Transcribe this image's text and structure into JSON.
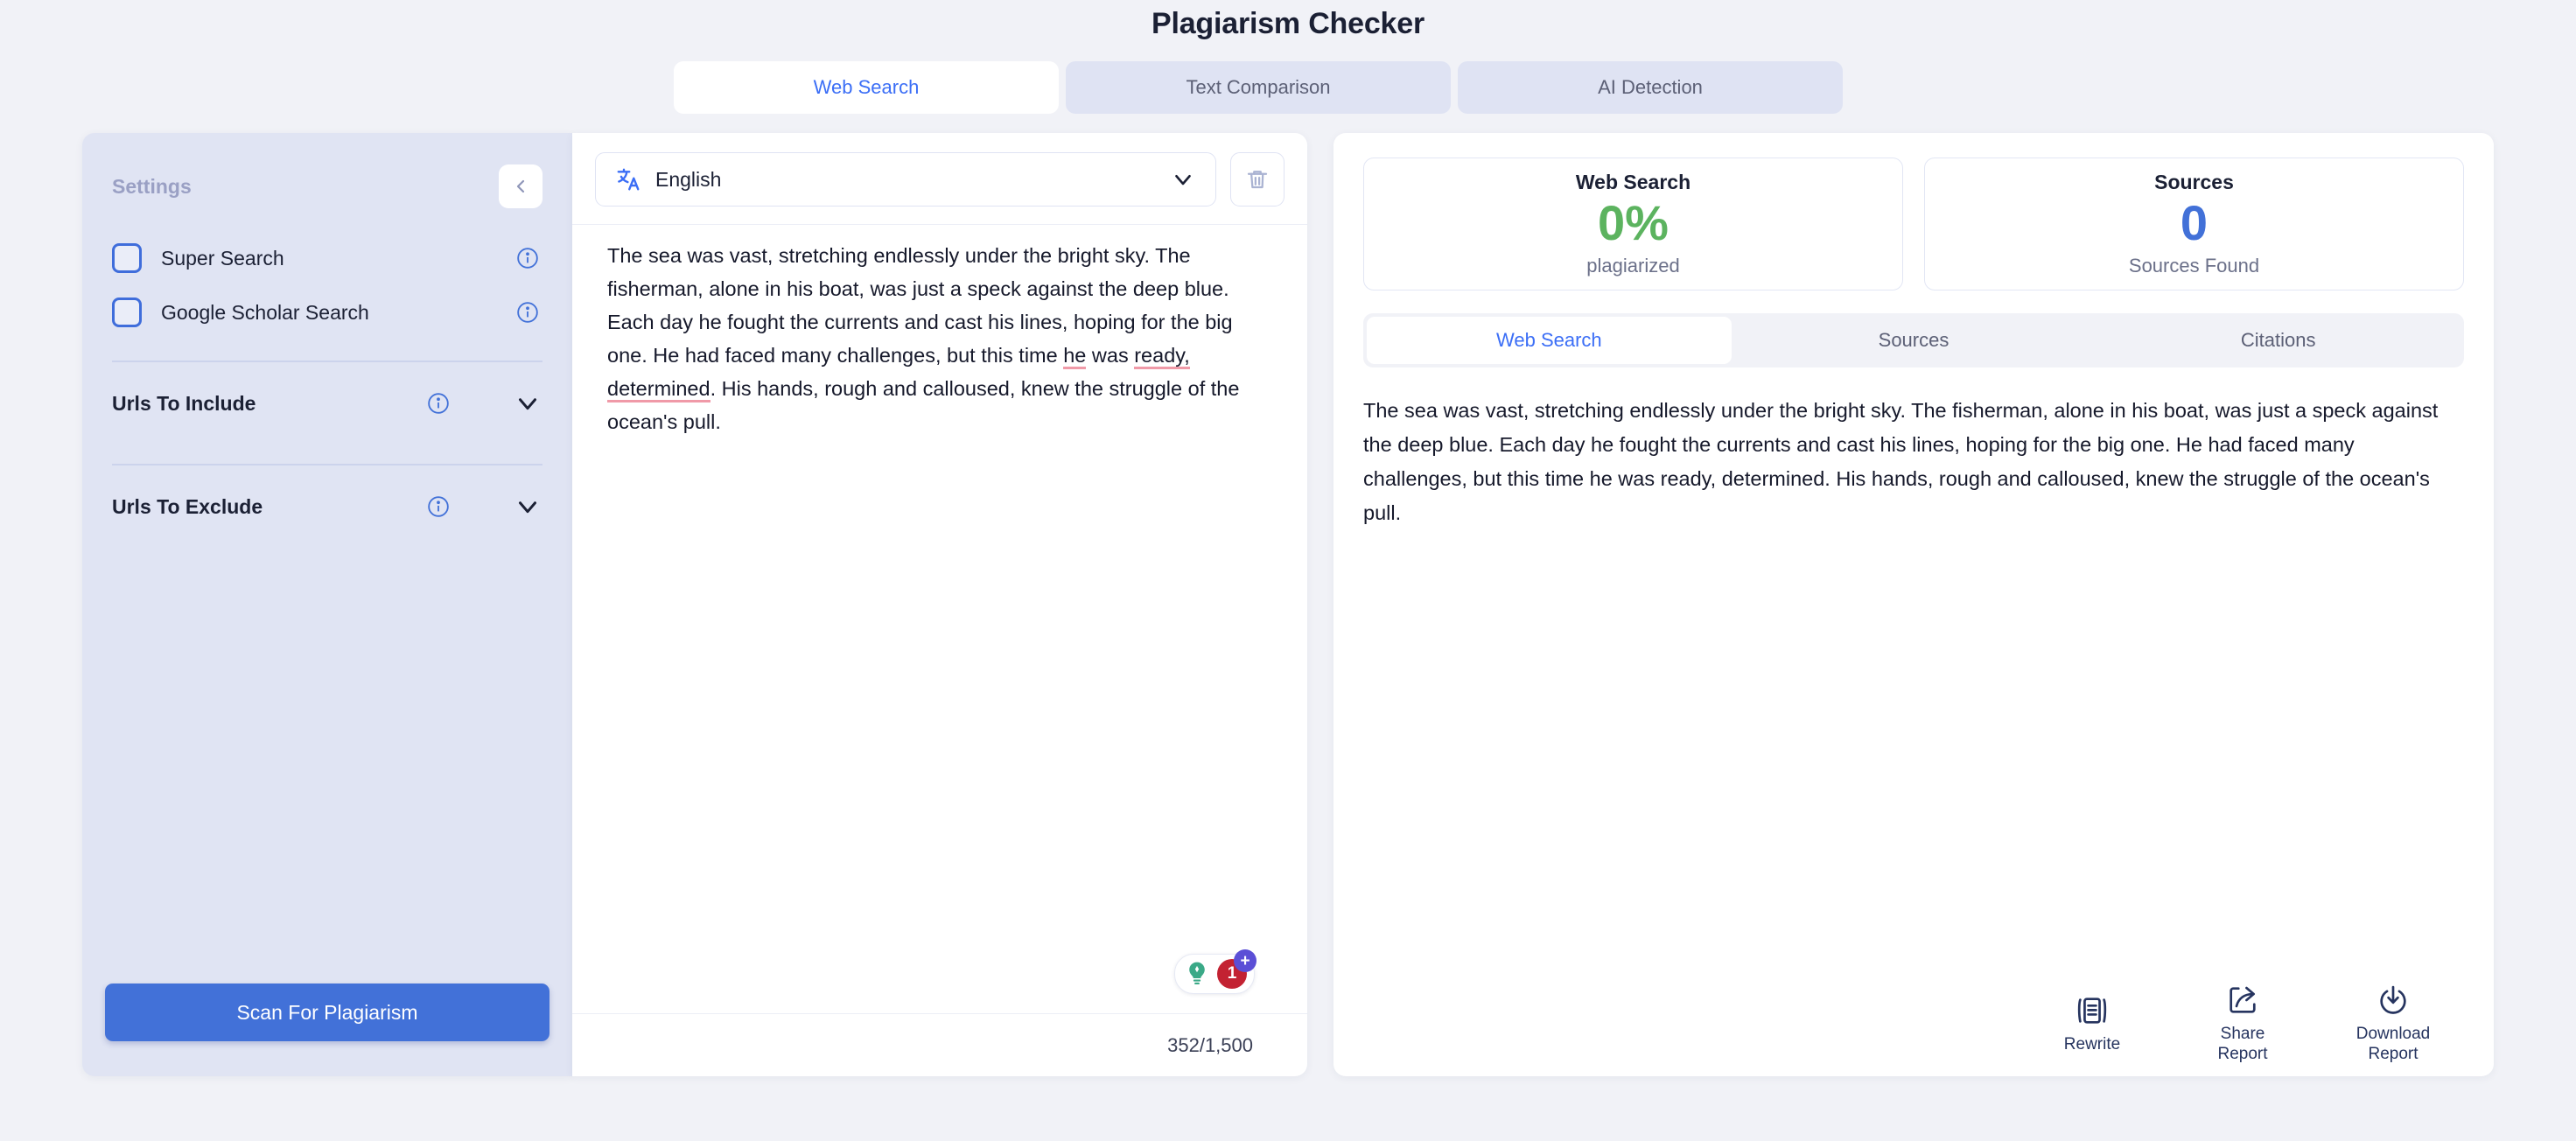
{
  "header": {
    "title": "Plagiarism Checker",
    "tabs": [
      {
        "label": "Web Search",
        "active": true
      },
      {
        "label": "Text Comparison",
        "active": false
      },
      {
        "label": "AI Detection",
        "active": false
      }
    ]
  },
  "sidebar": {
    "title": "Settings",
    "collapse_icon": "chevron-left-icon",
    "checkboxes": [
      {
        "label": "Super Search",
        "checked": false,
        "info_icon": "info-icon"
      },
      {
        "label": "Google Scholar Search",
        "checked": false,
        "info_icon": "info-icon"
      }
    ],
    "accordions": [
      {
        "label": "Urls To Include",
        "info_icon": "info-icon",
        "chevron": "chevron-down-icon"
      },
      {
        "label": "Urls To Exclude",
        "info_icon": "info-icon",
        "chevron": "chevron-down-icon"
      }
    ],
    "scan_button": "Scan For Plagiarism"
  },
  "editor": {
    "language": "English",
    "language_icon": "translate-icon",
    "chevron_icon": "chevron-down-icon",
    "delete_icon": "trash-icon",
    "text_parts": [
      {
        "t": "The sea was vast, stretching endlessly under the bright sky. The fisherman, alone in his boat, was just a speck against the deep blue. Each day he fought the currents and cast his lines, hoping for the big one. He had faced many challenges, but this time ",
        "mis": false
      },
      {
        "t": "he",
        "mis": true
      },
      {
        "t": " was ",
        "mis": false
      },
      {
        "t": "ready,",
        "mis": true
      },
      {
        "t": " ",
        "mis": false
      },
      {
        "t": "determined",
        "mis": true
      },
      {
        "t": ". His hands, rough and calloused, knew the struggle of the ocean's pull.",
        "mis": false
      }
    ],
    "grammar_badge": {
      "bulb_icon": "lightbulb-icon",
      "error_count": "1",
      "plus_label": "+"
    },
    "char_count": "352/1,500"
  },
  "results": {
    "stats": [
      {
        "title": "Web Search",
        "value": "0%",
        "sub": "plagiarized",
        "color": "#5cb35f"
      },
      {
        "title": "Sources",
        "value": "0",
        "sub": "Sources Found",
        "color": "#4271d8"
      }
    ],
    "tabs": [
      {
        "label": "Web Search",
        "active": true
      },
      {
        "label": "Sources",
        "active": false
      },
      {
        "label": "Citations",
        "active": false
      }
    ],
    "text": "The sea was vast, stretching endlessly under the bright sky. The fisherman, alone in his boat, was just a speck against the deep blue. Each day he fought the currents and cast his lines, hoping for the big one. He had faced many challenges, but this time he was ready, determined. His hands, rough and calloused, knew the struggle of the ocean's pull.",
    "actions": [
      {
        "label": "Rewrite",
        "icon": "rewrite-document-icon"
      },
      {
        "label": "Share Report",
        "icon": "share-icon"
      },
      {
        "label": "Download Report",
        "icon": "download-icon"
      }
    ]
  },
  "colors": {
    "accent_blue": "#4271d8",
    "link_blue": "#3b6ef6",
    "green": "#5cb35f",
    "error_red": "#c32232",
    "sidebar_bg": "#e0e4f3",
    "page_bg": "#f1f2f7"
  }
}
